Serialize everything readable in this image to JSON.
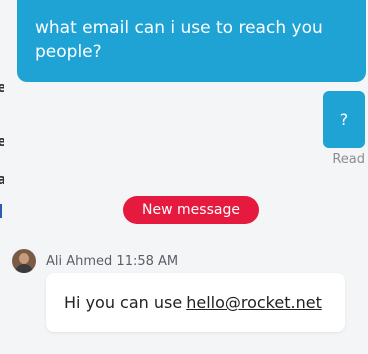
{
  "edge_glyphs": [
    "e",
    "e",
    "a"
  ],
  "conversation": {
    "outgoing": [
      {
        "text": "what email can i use to reach you people?"
      },
      {
        "text": "?"
      }
    ],
    "read_status": "Read",
    "new_message_label": "New message",
    "incoming": {
      "sender_meta": "Ali Ahmed 11:58 AM",
      "text": "Hi you can use",
      "link_text": "hello@rocket.net"
    }
  },
  "colors": {
    "outgoing_bubble": "#1fa3d4",
    "new_message_pill": "#e51a3e",
    "background": "#f4f5f7"
  }
}
